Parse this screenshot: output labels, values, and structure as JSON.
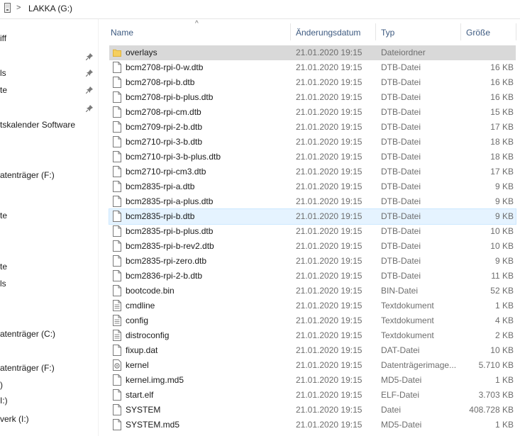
{
  "address": {
    "drive_label": "LAKKA (G:)",
    "separator": ">"
  },
  "navpane": {
    "items": [
      {
        "label": "iff",
        "pinned": false
      },
      {
        "label": "",
        "pinned": true
      },
      {
        "label": "ls",
        "pinned": true
      },
      {
        "label": "te",
        "pinned": true
      },
      {
        "label": "",
        "pinned": true
      },
      {
        "label": "tskalender Software",
        "pinned": false
      },
      {
        "label": "atenträger (F:)",
        "pinned": false
      },
      {
        "label": "te",
        "pinned": false
      },
      {
        "label": "te",
        "pinned": false
      },
      {
        "label": "ls",
        "pinned": false
      },
      {
        "label": "atenträger (C:)",
        "pinned": false
      },
      {
        "label": "atenträger (F:)",
        "pinned": false
      },
      {
        "label": ")",
        "pinned": false
      },
      {
        "label": "I:)",
        "pinned": false
      },
      {
        "label": "verk (I:)",
        "pinned": false
      }
    ]
  },
  "columns": {
    "name": "Name",
    "date": "Änderungsdatum",
    "type": "Typ",
    "size": "Größe",
    "sort_indicator": "^"
  },
  "files": [
    {
      "name": "overlays",
      "date": "21.01.2020 19:15",
      "type": "Dateiordner",
      "size": "",
      "icon": "folder-icon",
      "state": "selected"
    },
    {
      "name": "bcm2708-rpi-0-w.dtb",
      "date": "21.01.2020 19:15",
      "type": "DTB-Datei",
      "size": "16 KB",
      "icon": "file-icon",
      "state": ""
    },
    {
      "name": "bcm2708-rpi-b.dtb",
      "date": "21.01.2020 19:15",
      "type": "DTB-Datei",
      "size": "16 KB",
      "icon": "file-icon",
      "state": ""
    },
    {
      "name": "bcm2708-rpi-b-plus.dtb",
      "date": "21.01.2020 19:15",
      "type": "DTB-Datei",
      "size": "16 KB",
      "icon": "file-icon",
      "state": ""
    },
    {
      "name": "bcm2708-rpi-cm.dtb",
      "date": "21.01.2020 19:15",
      "type": "DTB-Datei",
      "size": "15 KB",
      "icon": "file-icon",
      "state": ""
    },
    {
      "name": "bcm2709-rpi-2-b.dtb",
      "date": "21.01.2020 19:15",
      "type": "DTB-Datei",
      "size": "17 KB",
      "icon": "file-icon",
      "state": ""
    },
    {
      "name": "bcm2710-rpi-3-b.dtb",
      "date": "21.01.2020 19:15",
      "type": "DTB-Datei",
      "size": "18 KB",
      "icon": "file-icon",
      "state": ""
    },
    {
      "name": "bcm2710-rpi-3-b-plus.dtb",
      "date": "21.01.2020 19:15",
      "type": "DTB-Datei",
      "size": "18 KB",
      "icon": "file-icon",
      "state": ""
    },
    {
      "name": "bcm2710-rpi-cm3.dtb",
      "date": "21.01.2020 19:15",
      "type": "DTB-Datei",
      "size": "17 KB",
      "icon": "file-icon",
      "state": ""
    },
    {
      "name": "bcm2835-rpi-a.dtb",
      "date": "21.01.2020 19:15",
      "type": "DTB-Datei",
      "size": "9 KB",
      "icon": "file-icon",
      "state": ""
    },
    {
      "name": "bcm2835-rpi-a-plus.dtb",
      "date": "21.01.2020 19:15",
      "type": "DTB-Datei",
      "size": "9 KB",
      "icon": "file-icon",
      "state": ""
    },
    {
      "name": "bcm2835-rpi-b.dtb",
      "date": "21.01.2020 19:15",
      "type": "DTB-Datei",
      "size": "9 KB",
      "icon": "file-icon",
      "state": "hover"
    },
    {
      "name": "bcm2835-rpi-b-plus.dtb",
      "date": "21.01.2020 19:15",
      "type": "DTB-Datei",
      "size": "10 KB",
      "icon": "file-icon",
      "state": ""
    },
    {
      "name": "bcm2835-rpi-b-rev2.dtb",
      "date": "21.01.2020 19:15",
      "type": "DTB-Datei",
      "size": "10 KB",
      "icon": "file-icon",
      "state": ""
    },
    {
      "name": "bcm2835-rpi-zero.dtb",
      "date": "21.01.2020 19:15",
      "type": "DTB-Datei",
      "size": "9 KB",
      "icon": "file-icon",
      "state": ""
    },
    {
      "name": "bcm2836-rpi-2-b.dtb",
      "date": "21.01.2020 19:15",
      "type": "DTB-Datei",
      "size": "11 KB",
      "icon": "file-icon",
      "state": ""
    },
    {
      "name": "bootcode.bin",
      "date": "21.01.2020 19:15",
      "type": "BIN-Datei",
      "size": "52 KB",
      "icon": "file-icon",
      "state": ""
    },
    {
      "name": "cmdline",
      "date": "21.01.2020 19:15",
      "type": "Textdokument",
      "size": "1 KB",
      "icon": "text-file-icon",
      "state": ""
    },
    {
      "name": "config",
      "date": "21.01.2020 19:15",
      "type": "Textdokument",
      "size": "4 KB",
      "icon": "text-file-icon",
      "state": ""
    },
    {
      "name": "distroconfig",
      "date": "21.01.2020 19:15",
      "type": "Textdokument",
      "size": "2 KB",
      "icon": "text-file-icon",
      "state": ""
    },
    {
      "name": "fixup.dat",
      "date": "21.01.2020 19:15",
      "type": "DAT-Datei",
      "size": "10 KB",
      "icon": "file-icon",
      "state": ""
    },
    {
      "name": "kernel",
      "date": "21.01.2020 19:15",
      "type": "Datenträgerimage...",
      "size": "5.710 KB",
      "icon": "disk-image-icon",
      "state": ""
    },
    {
      "name": "kernel.img.md5",
      "date": "21.01.2020 19:15",
      "type": "MD5-Datei",
      "size": "1 KB",
      "icon": "file-icon",
      "state": ""
    },
    {
      "name": "start.elf",
      "date": "21.01.2020 19:15",
      "type": "ELF-Datei",
      "size": "3.703 KB",
      "icon": "file-icon",
      "state": ""
    },
    {
      "name": "SYSTEM",
      "date": "21.01.2020 19:15",
      "type": "Datei",
      "size": "408.728 KB",
      "icon": "file-icon",
      "state": ""
    },
    {
      "name": "SYSTEM.md5",
      "date": "21.01.2020 19:15",
      "type": "MD5-Datei",
      "size": "1 KB",
      "icon": "file-icon",
      "state": ""
    }
  ],
  "colors": {
    "header_text": "#3d5a80",
    "selected_bg": "#d9d9d9",
    "hover_bg": "#e5f3ff",
    "folder": "#f5cf5f",
    "muted_text": "#6d6d6d"
  }
}
